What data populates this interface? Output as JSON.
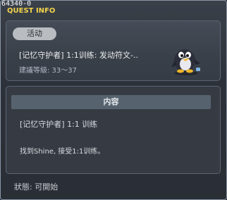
{
  "window": {
    "id_tag": "64340-0",
    "title": "QUEST INFO"
  },
  "quest": {
    "badge": "活动",
    "name": "[记忆守护者] 1:1训练: 发动符文-..",
    "level": "建議等級: 33～37",
    "character_icon": "penguin-character-icon"
  },
  "content": {
    "header": "内容",
    "title": "[记忆守护者] 1:1 训练",
    "description": "找到Shine, 接受1:1训练。"
  },
  "status": "狀態: 可開始",
  "colors": {
    "title": "#f2d34a",
    "badge_bg": "#b9bcc1",
    "panel_bg": "#3a4049",
    "header_bg": "#56636f"
  }
}
